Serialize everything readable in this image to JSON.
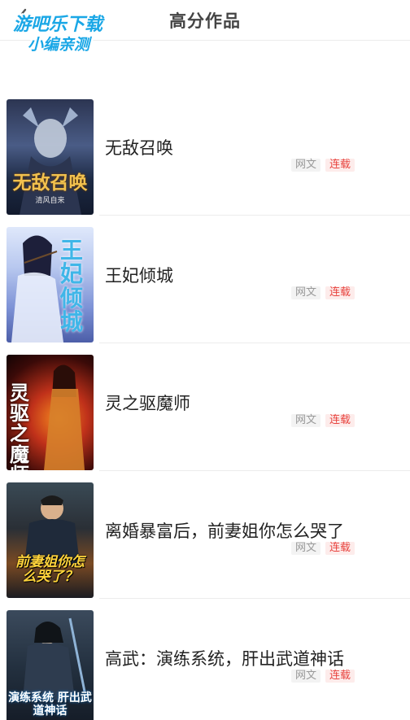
{
  "header": {
    "title": "高分作品",
    "back_icon": "back-arrow-icon"
  },
  "watermark": {
    "line1": "游吧乐下载",
    "line2": "小编亲测"
  },
  "books": [
    {
      "title": "无敌召唤",
      "genre": "网文",
      "status": "连载",
      "cover_text": "无敌召唤",
      "cover_author": "清风自来"
    },
    {
      "title": "王妃倾城",
      "genre": "网文",
      "status": "连载",
      "cover_text": "王妃倾城",
      "cover_author": ""
    },
    {
      "title": "灵之驱魔师",
      "genre": "网文",
      "status": "连载",
      "cover_text": "灵驱之魔师",
      "cover_author": ""
    },
    {
      "title": "离婚暴富后，前妻姐你怎么哭了",
      "genre": "网文",
      "status": "连载",
      "cover_text": "前妻姐你怎么哭了？",
      "cover_author": ""
    },
    {
      "title": "高武：演练系统，肝出武道神话",
      "genre": "网文",
      "status": "连载",
      "cover_text": "演练系统 肝出武道神话",
      "cover_author": ""
    }
  ],
  "colors": {
    "status_tag": "#e8443f",
    "genre_tag": "#999999",
    "watermark": "#1aa7e6"
  }
}
